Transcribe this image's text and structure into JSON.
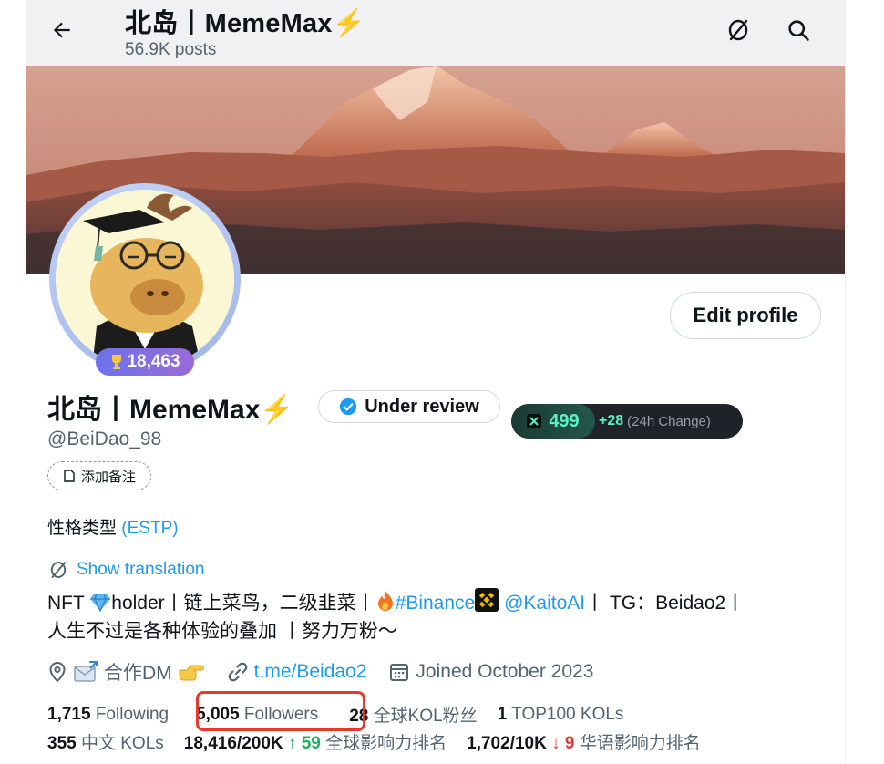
{
  "header": {
    "title": "北岛丨MemeMax⚡️",
    "posts": "56.9K posts"
  },
  "profile": {
    "name": "北岛丨MemeMax⚡️",
    "handle": "@BeiDao_98",
    "score_badge": "18,463",
    "review_label": "Under review",
    "edit_label": "Edit profile",
    "note_label": "添加备注",
    "mbti_label": "性格类型",
    "mbti_value": "(ESTP)",
    "translate_label": "Show translation"
  },
  "kol_score": {
    "value": "499",
    "change": "+28",
    "change_label": "(24h Change)"
  },
  "bio": {
    "part1": "NFT ",
    "part2": "holder丨链上菜鸟，二级韭菜丨",
    "hashtag": "#Binance",
    "mention": "@KaitoAI",
    "part3": "丨 TG：Beidao2丨",
    "line2": "人生不过是各种体验的叠加 丨努力万粉～"
  },
  "meta": {
    "location": "合作DM",
    "link": "t.me/Beidao2",
    "joined": "Joined October 2023"
  },
  "stats": {
    "following_num": "1,715",
    "following_label": "Following",
    "followers_num": "5,005",
    "followers_label": "Followers",
    "kol_fans_num": "28",
    "kol_fans_label": "全球KOL粉丝",
    "top100_num": "1",
    "top100_label": "TOP100 KOLs",
    "cn_kols_num": "355",
    "cn_kols_label": "中文 KOLs",
    "global_rank_num": "18,416/200K",
    "global_rank_change": "59",
    "global_rank_label": "全球影响力排名",
    "cn_rank_num": "1,702/10K",
    "cn_rank_change": "9",
    "cn_rank_label": "华语影响力排名"
  },
  "colors": {
    "accent": "#1d9bf0",
    "highlight_box": "#e4392b",
    "rank_up": "#1fae5a",
    "rank_down": "#e0393e",
    "kol_green": "#5af0c6"
  }
}
